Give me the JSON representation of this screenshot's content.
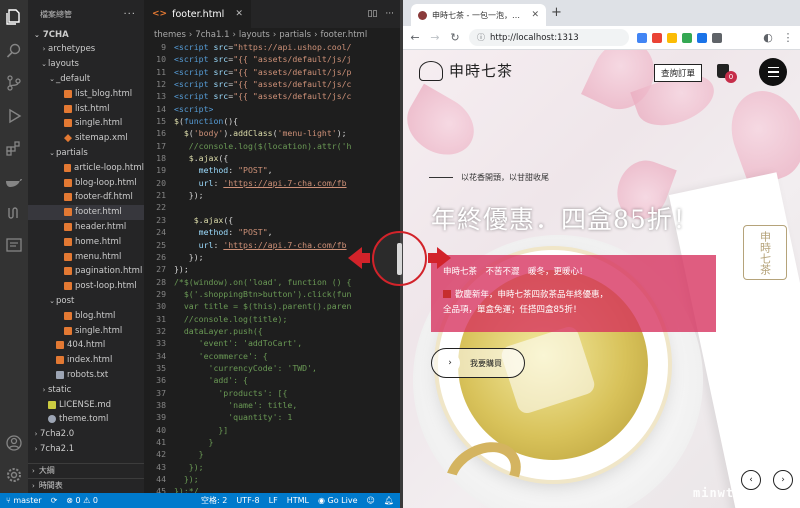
{
  "vscode": {
    "explorer_title": "檔案總管",
    "root_folder": "7CHA",
    "tree": [
      {
        "label": "archetypes",
        "indent": 1,
        "kind": "folder-closed"
      },
      {
        "label": "layouts",
        "indent": 1,
        "kind": "folder-open"
      },
      {
        "label": "_default",
        "indent": 2,
        "kind": "folder-open"
      },
      {
        "label": "list_blog.html",
        "indent": 3,
        "kind": "html"
      },
      {
        "label": "list.html",
        "indent": 3,
        "kind": "html"
      },
      {
        "label": "single.html",
        "indent": 3,
        "kind": "html"
      },
      {
        "label": "sitemap.xml",
        "indent": 3,
        "kind": "xml"
      },
      {
        "label": "partials",
        "indent": 2,
        "kind": "folder-open"
      },
      {
        "label": "article-loop.html",
        "indent": 3,
        "kind": "html"
      },
      {
        "label": "blog-loop.html",
        "indent": 3,
        "kind": "html"
      },
      {
        "label": "footer-df.html",
        "indent": 3,
        "kind": "html"
      },
      {
        "label": "footer.html",
        "indent": 3,
        "kind": "html",
        "selected": true
      },
      {
        "label": "header.html",
        "indent": 3,
        "kind": "html"
      },
      {
        "label": "home.html",
        "indent": 3,
        "kind": "html"
      },
      {
        "label": "menu.html",
        "indent": 3,
        "kind": "html"
      },
      {
        "label": "pagination.html",
        "indent": 3,
        "kind": "html"
      },
      {
        "label": "post-loop.html",
        "indent": 3,
        "kind": "html"
      },
      {
        "label": "post",
        "indent": 2,
        "kind": "folder-open"
      },
      {
        "label": "blog.html",
        "indent": 3,
        "kind": "html"
      },
      {
        "label": "single.html",
        "indent": 3,
        "kind": "html"
      },
      {
        "label": "404.html",
        "indent": 2,
        "kind": "html"
      },
      {
        "label": "index.html",
        "indent": 2,
        "kind": "html"
      },
      {
        "label": "robots.txt",
        "indent": 2,
        "kind": "txt"
      },
      {
        "label": "static",
        "indent": 1,
        "kind": "folder-closed"
      },
      {
        "label": "LICENSE.md",
        "indent": 1,
        "kind": "lic"
      },
      {
        "label": "theme.toml",
        "indent": 1,
        "kind": "toml"
      },
      {
        "label": "7cha2.0",
        "indent": 0,
        "kind": "folder-closed"
      },
      {
        "label": "7cha2.1",
        "indent": 0,
        "kind": "folder-closed"
      }
    ],
    "outline_label": "大綱",
    "timeline_label": "時間表",
    "tab_label": "footer.html",
    "breadcrumb": [
      "themes",
      "7cha1.1",
      "layouts",
      "partials",
      "footer.html"
    ],
    "code_lines": [
      {
        "n": "9",
        "html": "<span class='c-tag'>&lt;script</span> <span class='c-attr'>src</span>=<span class='c-str'>\"https://api.ushop.cool/</span>"
      },
      {
        "n": "10",
        "html": "<span class='c-tag'>&lt;script</span> <span class='c-attr'>src</span>=<span class='c-str'>\"{{ \"assets/default/js/j</span>"
      },
      {
        "n": "11",
        "html": "<span class='c-tag'>&lt;script</span> <span class='c-attr'>src</span>=<span class='c-str'>\"{{ \"assets/default/js/p</span>"
      },
      {
        "n": "12",
        "html": "<span class='c-tag'>&lt;script</span> <span class='c-attr'>src</span>=<span class='c-str'>\"{{ \"assets/default/js/c</span>"
      },
      {
        "n": "13",
        "html": "<span class='c-tag'>&lt;script</span> <span class='c-attr'>src</span>=<span class='c-str'>\"{{ \"assets/default/js/c</span>"
      },
      {
        "n": "14",
        "html": "<span class='c-tag'>&lt;script&gt;</span>"
      },
      {
        "n": "15",
        "html": "<span class='c-fn'>$</span>(<span class='c-key'>function</span>(){"
      },
      {
        "n": "16",
        "html": "  <span class='c-fn'>$</span>(<span class='c-str'>'body'</span>).<span class='c-fn'>addClass</span>(<span class='c-str'>'menu-light'</span>);"
      },
      {
        "n": "17",
        "html": "   <span class='c-com'>//console.log($(location).attr('h</span>"
      },
      {
        "n": "18",
        "html": "   <span class='c-fn'>$</span>.<span class='c-fn'>ajax</span>({"
      },
      {
        "n": "19",
        "html": "     <span class='c-attr'>method</span>: <span class='c-str'>\"POST\"</span>,"
      },
      {
        "n": "20",
        "html": "     <span class='c-attr'>url</span>: <span class='c-url'>'https://api.7-cha.com/fb</span>"
      },
      {
        "n": "21",
        "html": "   });"
      },
      {
        "n": "22",
        "html": ""
      },
      {
        "n": "23",
        "html": "    <span class='c-fn'>$</span>.<span class='c-fn'>ajax</span>({"
      },
      {
        "n": "24",
        "html": "     <span class='c-attr'>method</span>: <span class='c-str'>\"POST\"</span>,"
      },
      {
        "n": "25",
        "html": "     <span class='c-attr'>url</span>: <span class='c-url'>'https://api.7-cha.com/fb</span>"
      },
      {
        "n": "26",
        "html": "   });"
      },
      {
        "n": "27",
        "html": "});"
      },
      {
        "n": "28",
        "html": "<span class='c-com'>/*$(window).on('load', function () {</span>"
      },
      {
        "n": "29",
        "html": "  <span class='c-com'>$('.shoppingBtn>button').click(fun</span>"
      },
      {
        "n": "30",
        "html": "  <span class='c-com'>var title = $(this).parent().paren</span>"
      },
      {
        "n": "31",
        "html": "  <span class='c-com'>//console.log(title);</span>"
      },
      {
        "n": "32",
        "html": "  <span class='c-com'>dataLayer.push({</span>"
      },
      {
        "n": "33",
        "html": "     <span class='c-com'>'event': 'addToCart',</span>"
      },
      {
        "n": "34",
        "html": "     <span class='c-com'>'ecommerce': {</span>"
      },
      {
        "n": "35",
        "html": "       <span class='c-com'>'currencyCode': 'TWD',</span>"
      },
      {
        "n": "36",
        "html": "       <span class='c-com'>'add': {</span>"
      },
      {
        "n": "37",
        "html": "         <span class='c-com'>'products': [{</span>"
      },
      {
        "n": "38",
        "html": "           <span class='c-com'>'name': title,</span>"
      },
      {
        "n": "39",
        "html": "           <span class='c-com'>'quantity': 1</span>"
      },
      {
        "n": "40",
        "html": "         <span class='c-com'>}]</span>"
      },
      {
        "n": "41",
        "html": "       <span class='c-com'>}</span>"
      },
      {
        "n": "42",
        "html": "     <span class='c-com'>}</span>"
      },
      {
        "n": "43",
        "html": "   <span class='c-com'>});</span>"
      },
      {
        "n": "44",
        "html": "  <span class='c-com'>});</span>"
      },
      {
        "n": "45",
        "html": "<span class='c-com'>});*/</span>"
      }
    ],
    "status": {
      "branch": "master",
      "problems": "⊗ 0 ⚠ 0",
      "spaces": "空格: 2",
      "encoding": "UTF-8",
      "eol": "LF",
      "language": "HTML",
      "golive": "Go Live"
    },
    "colors": {
      "statusbar": "#007acc",
      "sidebar": "#252526",
      "editor": "#1e1e1e"
    }
  },
  "browser": {
    "tab_title": "申時七茶 - 一包一泡，就是現代",
    "address": "http://localhost:1313",
    "extensions": [
      "#4285f4",
      "#ea4335",
      "#fbbc05",
      "#34a853",
      "#1a73e8",
      "#5f6368"
    ]
  },
  "site": {
    "brand": "申時七茶",
    "query_order": "查詢訂單",
    "cart_count": "0",
    "tagline": "以花香開頭，以甘甜收尾",
    "headline": "年終優惠．四盒85折！",
    "promo_line1": "申時七茶　不苦不澀　暖冬，更暖心！",
    "promo_line2": "歡慶新年，申時七茶四款茶品年終優惠，",
    "promo_line3": "全品項，單盒免運；任搭四盒85折！",
    "buy_now": "我要購買",
    "seal_text": "申時七茶",
    "watermark": "minwt.com",
    "colors": {
      "promo": "#d6305c",
      "accent": "#d2232a"
    }
  }
}
